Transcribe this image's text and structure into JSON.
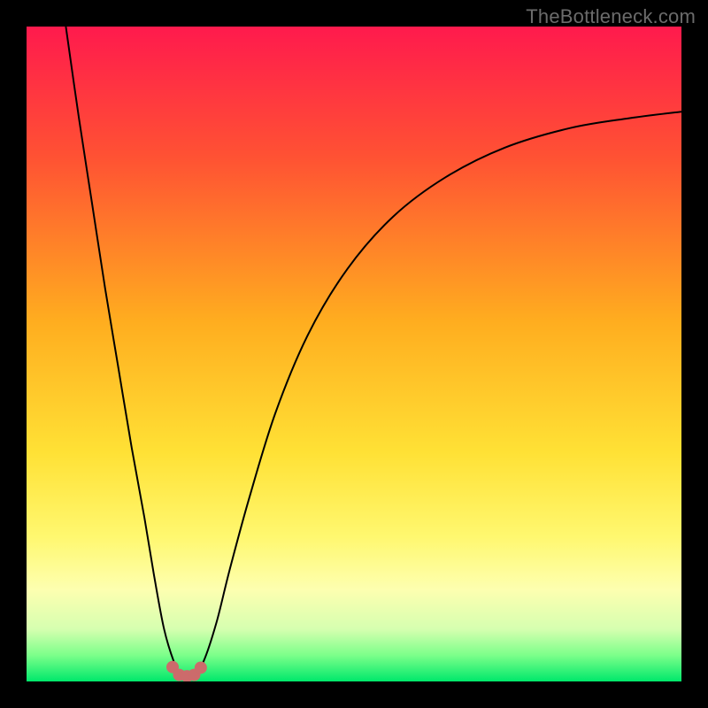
{
  "watermark": "TheBottleneck.com",
  "chart_data": {
    "type": "line",
    "title": "",
    "xlabel": "",
    "ylabel": "",
    "xlim": [
      0,
      100
    ],
    "ylim": [
      0,
      100
    ],
    "legend": false,
    "grid": false,
    "background_gradient": {
      "stops": [
        {
          "offset": 0.0,
          "color": "#ff1a4d"
        },
        {
          "offset": 0.2,
          "color": "#ff5233"
        },
        {
          "offset": 0.45,
          "color": "#ffad1f"
        },
        {
          "offset": 0.65,
          "color": "#ffe135"
        },
        {
          "offset": 0.78,
          "color": "#fff870"
        },
        {
          "offset": 0.86,
          "color": "#fdffb0"
        },
        {
          "offset": 0.92,
          "color": "#d6ffb0"
        },
        {
          "offset": 0.96,
          "color": "#7cff8a"
        },
        {
          "offset": 1.0,
          "color": "#00e86b"
        }
      ]
    },
    "series": [
      {
        "name": "bottleneck-curve",
        "color": "#000000",
        "width": 2,
        "points": [
          {
            "x": 6,
            "y": 100
          },
          {
            "x": 8,
            "y": 86
          },
          {
            "x": 10,
            "y": 73
          },
          {
            "x": 12,
            "y": 60
          },
          {
            "x": 14,
            "y": 48
          },
          {
            "x": 16,
            "y": 36
          },
          {
            "x": 18,
            "y": 25
          },
          {
            "x": 19.5,
            "y": 16
          },
          {
            "x": 21,
            "y": 8
          },
          {
            "x": 22.5,
            "y": 3
          },
          {
            "x": 23.5,
            "y": 1.2
          },
          {
            "x": 24.5,
            "y": 0.9
          },
          {
            "x": 25.5,
            "y": 1.1
          },
          {
            "x": 27,
            "y": 3
          },
          {
            "x": 29,
            "y": 9
          },
          {
            "x": 31,
            "y": 17
          },
          {
            "x": 34,
            "y": 28
          },
          {
            "x": 38,
            "y": 41
          },
          {
            "x": 43,
            "y": 53
          },
          {
            "x": 49,
            "y": 63
          },
          {
            "x": 56,
            "y": 71
          },
          {
            "x": 64,
            "y": 77
          },
          {
            "x": 73,
            "y": 81.5
          },
          {
            "x": 83,
            "y": 84.5
          },
          {
            "x": 92,
            "y": 86
          },
          {
            "x": 100,
            "y": 87
          }
        ]
      }
    ],
    "markers": {
      "name": "highlight-dots",
      "color": "#cc6b6b",
      "radius": 7,
      "points": [
        {
          "x": 22.3,
          "y": 2.2
        },
        {
          "x": 23.3,
          "y": 1.0
        },
        {
          "x": 24.5,
          "y": 0.8
        },
        {
          "x": 25.6,
          "y": 1.0
        },
        {
          "x": 26.6,
          "y": 2.1
        }
      ]
    }
  }
}
